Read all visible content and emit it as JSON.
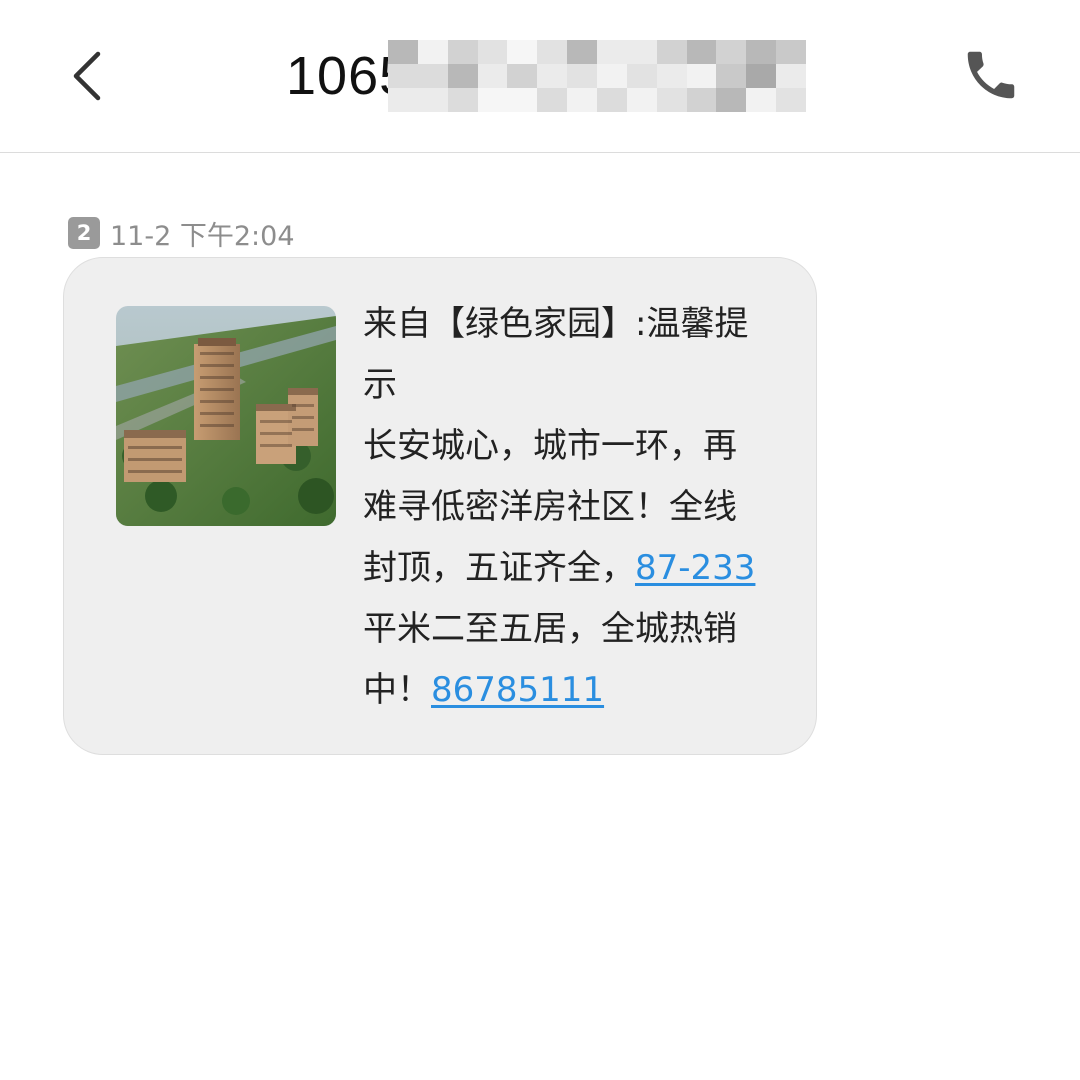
{
  "header": {
    "sender_visible": "1065",
    "back_icon": "chevron-left-icon",
    "call_icon": "phone-icon"
  },
  "message": {
    "sim_slot": "2",
    "timestamp": "11-2 下午2:04",
    "lines": [
      "来自【绿色家园】:温馨提",
      "示",
      "长安城心，城市一环，再",
      "难寻低密洋房社区！全线",
      "封顶，五证齐全，",
      "平米二至五居，全城热销",
      "中！"
    ],
    "link_area": "87-233",
    "link_phone": "86785111"
  },
  "colors": {
    "bubble_bg": "#efefef",
    "link": "#2a8ee0",
    "timestamp": "#8d8d8d",
    "badge": "#9a9a9a"
  }
}
